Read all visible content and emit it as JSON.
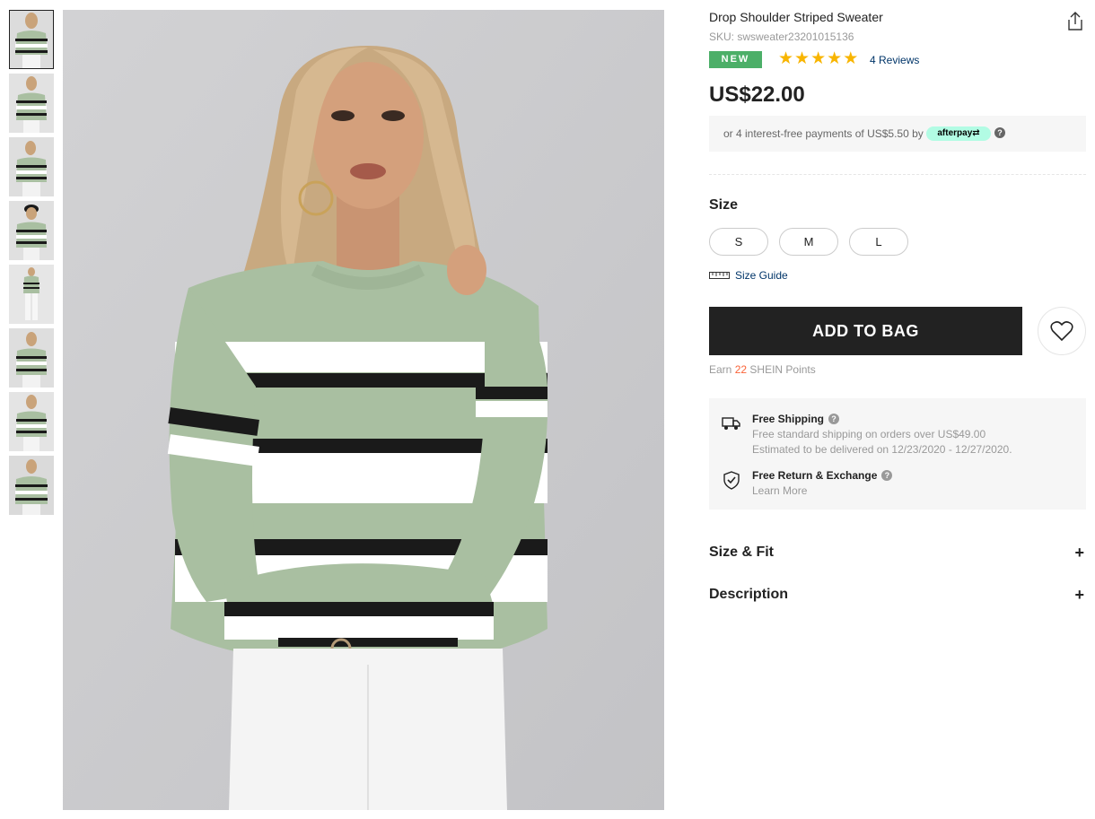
{
  "product": {
    "title": "Drop Shoulder Striped Sweater",
    "sku": "SKU: swsweater23201015136",
    "badge": "NEW",
    "rating": 5,
    "stars": [
      "★",
      "★",
      "★",
      "★",
      "★"
    ],
    "reviews_label": "4 Reviews",
    "price": "US$22.00"
  },
  "afterpay": {
    "text": "or 4 interest-free payments of US$5.50 by",
    "badge": "afterpay⇄",
    "help": "?"
  },
  "size": {
    "label": "Size",
    "options": [
      "S",
      "M",
      "L"
    ],
    "guide_label": "Size Guide"
  },
  "actions": {
    "add_to_bag": "ADD TO BAG",
    "wishlist_icon": "heart-icon",
    "share_icon": "share-icon"
  },
  "points": {
    "prefix": "Earn",
    "value": "22",
    "suffix": "SHEIN Points"
  },
  "shipping": {
    "free_shipping_title": "Free Shipping",
    "free_shipping_line1": "Free standard shipping on orders over US$49.00",
    "free_shipping_line2": "Estimated to be delivered on 12/23/2020 - 12/27/2020.",
    "return_title": "Free Return & Exchange",
    "return_link": "Learn More",
    "help": "?"
  },
  "accordions": [
    {
      "label": "Size & Fit",
      "icon": "+"
    },
    {
      "label": "Description",
      "icon": "+"
    }
  ],
  "colors": {
    "accent_new": "#4caf68",
    "star": "#f8b500",
    "link": "#003569",
    "points": "#fa6338",
    "button": "#222222",
    "afterpay": "#b2fce4",
    "sweater_green": "#a9bfa1"
  },
  "gallery": {
    "thumbnail_count": 8,
    "active_index": 0
  }
}
